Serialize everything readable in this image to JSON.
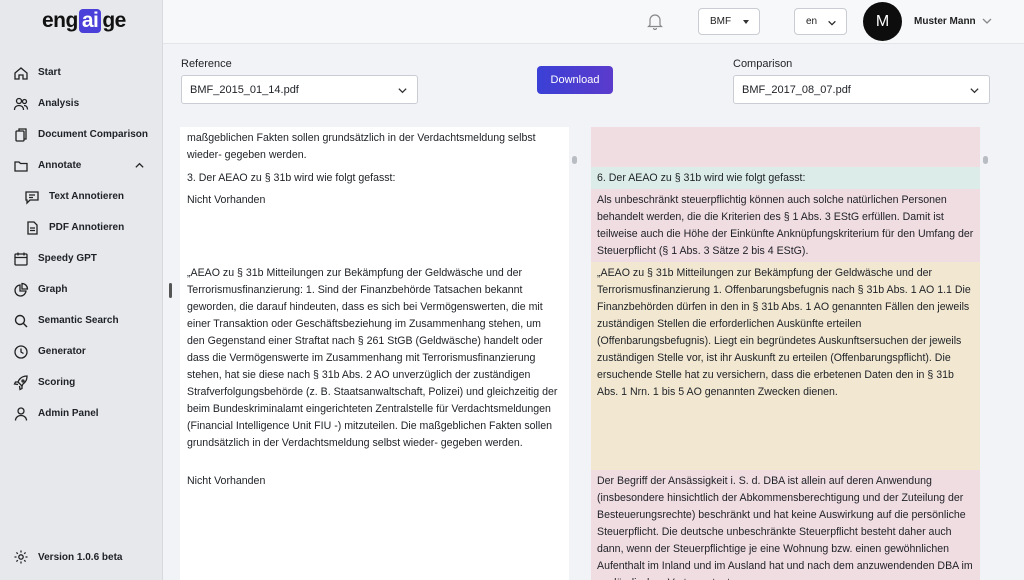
{
  "brand": {
    "prefix": "eng",
    "ai": "ai",
    "suffix": "ge"
  },
  "sidebar": {
    "items": [
      {
        "label": "Start",
        "icon": "home-icon"
      },
      {
        "label": "Analysis",
        "icon": "users-icon"
      },
      {
        "label": "Document Comparison",
        "icon": "documents-icon"
      },
      {
        "label": "Annotate",
        "icon": "folder-icon"
      },
      {
        "label": "Text Annotieren",
        "icon": "comment-icon"
      },
      {
        "label": "PDF Annotieren",
        "icon": "file-icon"
      },
      {
        "label": "Speedy GPT",
        "icon": "calendar-icon"
      },
      {
        "label": "Graph",
        "icon": "pie-chart-icon"
      },
      {
        "label": "Semantic Search",
        "icon": "search-icon"
      },
      {
        "label": "Generator",
        "icon": "clock-icon"
      },
      {
        "label": "Scoring",
        "icon": "rocket-icon"
      },
      {
        "label": "Admin Panel",
        "icon": "user-icon"
      }
    ],
    "version": "Version 1.0.6 beta"
  },
  "topbar": {
    "org_select": "BMF",
    "lang_select": "en",
    "avatar_initial": "M",
    "user_name": "Muster Mann"
  },
  "comparison": {
    "reference_label": "Reference",
    "reference_file": "BMF_2015_01_14.pdf",
    "comparison_label": "Comparison",
    "comparison_file": "BMF_2017_08_07.pdf",
    "download_label": "Download"
  },
  "left_blocks": [
    "maßgeblichen Fakten sollen grundsätzlich in der Verdachtsmeldung selbst wieder- gegeben werden.",
    "3. Der AEAO zu § 31b wird wie folgt gefasst:",
    "Nicht Vorhanden",
    "„AEAO zu § 31b Mitteilungen zur Bekämpfung der Geldwäsche und der Terrorismusfinanzierung: 1. Sind der Finanzbehörde Tatsachen bekannt geworden, die darauf hindeuten, dass es sich bei Vermögenswerten, die mit einer Transaktion oder Geschäftsbeziehung im Zusammenhang stehen, um den Gegenstand einer Straftat nach § 261 StGB (Geldwäsche) handelt oder dass die Vermögenswerte im Zusammenhang mit Terrorismusfinanzierung stehen, hat sie diese nach § 31b Abs. 2 AO unverzüglich der zuständigen Strafverfolgungsbehörde (z. B. Staatsanwaltschaft, Polizei) und gleichzeitig der beim Bundeskriminalamt eingerichteten Zentralstelle für Verdachtsmeldungen (Financial Intelligence Unit FIU -) mitzuteilen. Die maßgeblichen Fakten sollen grundsätzlich in der Verdachtsmeldung selbst wieder- gegeben werden.",
    "Nicht Vorhanden"
  ],
  "right_blocks": [
    {
      "text": "",
      "color": "#f0dde2"
    },
    {
      "text": "6. Der AEAO zu § 31b wird wie folgt gefasst:",
      "color": "#dcece8"
    },
    {
      "text": "Als unbeschränkt steuerpflichtig können auch solche natürlichen Personen behandelt werden, die die Kriterien des § 1 Abs. 3 EStG erfüllen. Damit ist teilweise auch die Höhe der Einkünfte Anknüpfungskriterium für den Umfang der Steuerpflicht (§ 1 Abs. 3 Sätze 2 bis 4 EStG).",
      "color": "#f0dde2"
    },
    {
      "text": "„AEAO zu § 31b Mitteilungen zur Bekämpfung der Geldwäsche und der Terrorismusfinanzierung 1. Offenbarungsbefugnis nach § 31b Abs. 1 AO 1.1 Die Finanzbehörden dürfen in den in § 31b Abs. 1 AO genannten Fällen den jeweils zuständigen Stellen die erforderlichen Auskünfte erteilen (Offenbarungsbefugnis). Liegt ein begründetes Auskunftsersuchen der jeweils zuständigen Stelle vor, ist ihr Auskunft zu erteilen (Offenbarungspflicht). Die ersuchende Stelle hat zu versichern, dass die erbetenen Daten den in § 31b Abs. 1 Nrn. 1 bis 5 AO genannten Zwecken dienen.",
      "color": "#f2e8d2"
    },
    {
      "text": "Der Begriff der Ansässigkeit i. S. d. DBA ist allein auf deren Anwendung (insbesondere hinsichtlich der Abkommensberechtigung und der Zuteilung der Besteuerungsrechte) beschränkt und hat keine Auswirkung auf die persönliche Steuerpflicht. Die deutsche unbeschränkte Steuerpflicht besteht daher auch dann, wenn der Steuerpflichtige je eine Wohnung bzw. einen gewöhnlichen Aufenthalt im Inland und im Ausland hat und nach dem anzuwendenden DBA im ausländischen Vertragsstaat",
      "color": "#f0dde2"
    }
  ]
}
